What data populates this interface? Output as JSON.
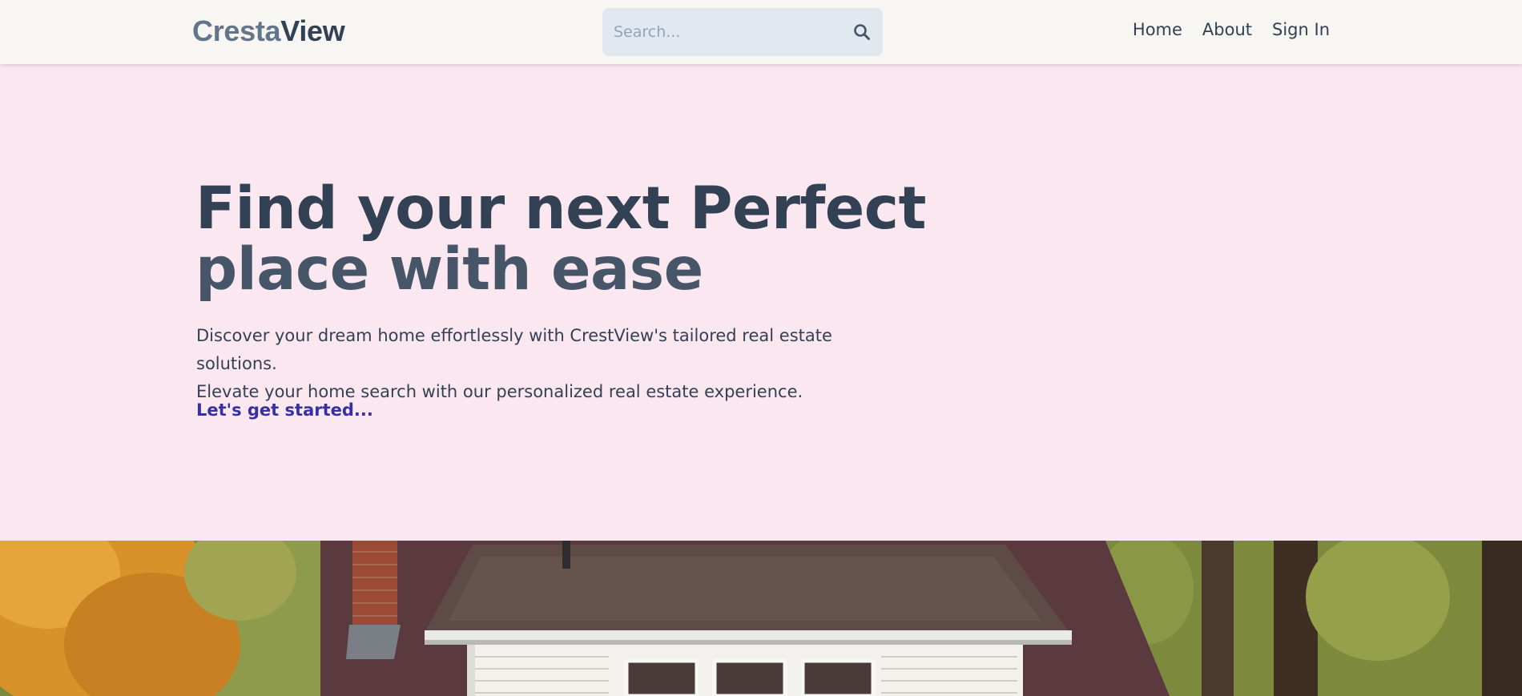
{
  "header": {
    "brand_part1": "Cresta",
    "brand_part2": "View",
    "search_placeholder": "Search...",
    "search_icon": "search-icon",
    "nav": [
      "Home",
      "About",
      "Sign In"
    ]
  },
  "hero": {
    "title_line1": "Find your next Perfect",
    "title_line2": "place with ease",
    "desc_line1": "Discover your dream home effortlessly with CrestView's tailored real estate solutions.",
    "desc_line2": "Elevate your home search with our personalized real estate experience.",
    "cta": "Let's get started..."
  },
  "colors": {
    "header_bg": "#f7f6f2",
    "hero_bg": "#fbe7ef",
    "brand_light": "#64748b",
    "brand_dark": "#334155",
    "search_bg": "#e2e8f0",
    "cta": "#3730a3"
  },
  "photo": {
    "subject": "house-photo"
  }
}
